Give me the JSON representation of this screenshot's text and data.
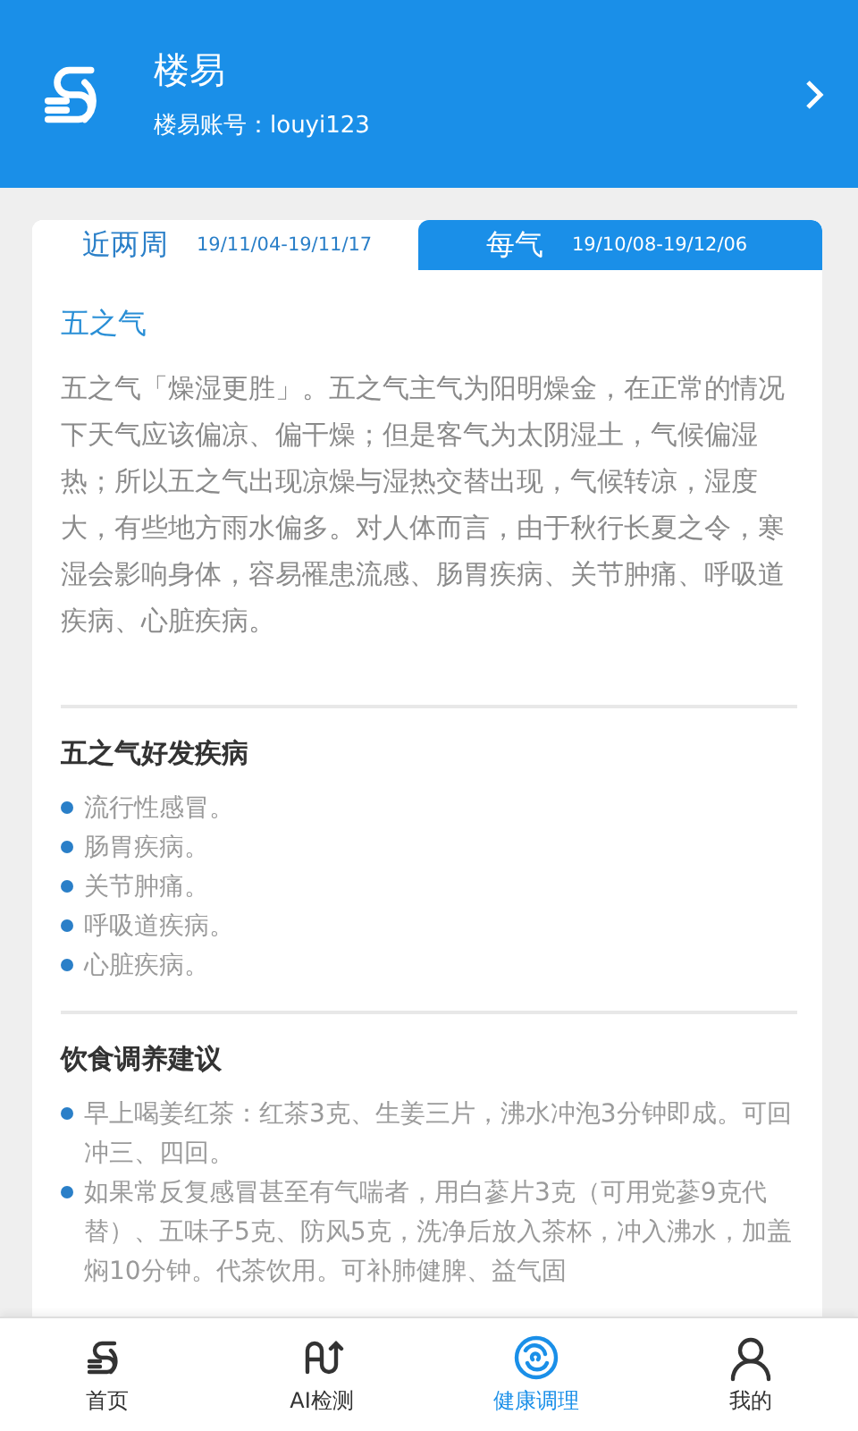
{
  "header": {
    "title": "楼易",
    "account": "楼易账号：louyi123"
  },
  "tabs": [
    {
      "label": "近两周",
      "range": "19/11/04-19/11/17",
      "selected": false
    },
    {
      "label": "每气",
      "range": "19/10/08-19/12/06",
      "selected": true
    }
  ],
  "intro": {
    "title": "五之气",
    "text": "五之气「燥湿更胜」。五之气主气为阳明燥金，在正常的情况下天气应该偏凉、偏干燥；但是客气为太阴湿土，气候偏湿热；所以五之气出现凉燥与湿热交替出现，气候转凉，湿度大，有些地方雨水偏多。对人体而言，由于秋行长夏之令，寒湿会影响身体，容易罹患流感、肠胃疾病、关节肿痛、呼吸道疾病、心脏疾病。"
  },
  "sections": [
    {
      "title": "五之气好发疾病",
      "items": [
        "流行性感冒。",
        "肠胃疾病。",
        "关节肿痛。",
        "呼吸道疾病。",
        "心脏疾病。"
      ]
    },
    {
      "title": "饮食调养建议",
      "items": [
        "早上喝姜红茶：红茶3克、生姜三片，沸水冲泡3分钟即成。可回冲三、四回。",
        "如果常反复感冒甚至有气喘者，用白蔘片3克（可用党蔘9克代替）、五味子5克、防风5克，洗净后放入茶杯，冲入沸水，加盖焖10分钟。代茶饮用。可补肺健脾、益气固"
      ]
    }
  ],
  "nav": [
    {
      "kind": "home",
      "label": "首页",
      "selected": false
    },
    {
      "kind": "ai",
      "label": "AI检测",
      "selected": false
    },
    {
      "kind": "health",
      "label": "健康调理",
      "selected": true
    },
    {
      "kind": "user",
      "label": "我的",
      "selected": false
    }
  ]
}
